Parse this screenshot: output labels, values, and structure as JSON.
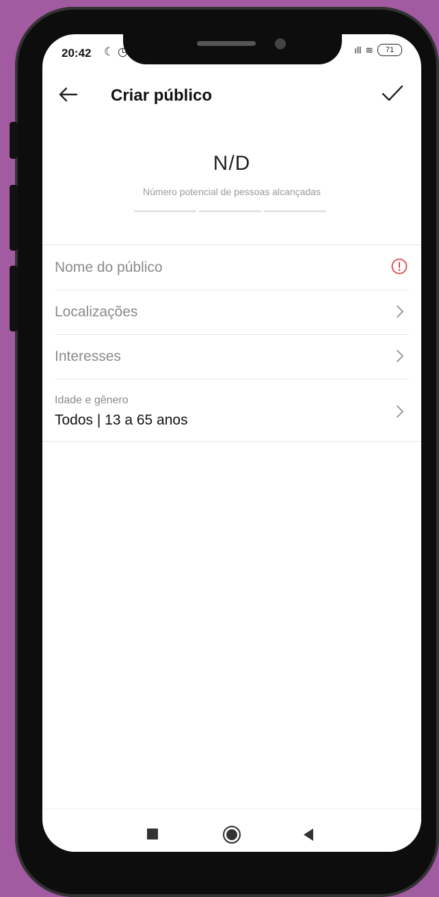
{
  "status_bar": {
    "time": "20:42",
    "left_icons": "☾ ◷",
    "signal": "ıll",
    "wifi": "≋",
    "battery": "71"
  },
  "header": {
    "title": "Criar público",
    "back_icon": "arrow-left-icon",
    "confirm_icon": "checkmark-icon"
  },
  "reach": {
    "value": "N/D",
    "caption": "Número potencial de pessoas alcançadas"
  },
  "form": {
    "audience_name": {
      "label": "Nome do público",
      "icon": "warning-icon",
      "warning_color": "#e0474c"
    },
    "locations": {
      "label": "Localizações"
    },
    "interests": {
      "label": "Interesses"
    },
    "age_gender": {
      "label": "Idade e gênero",
      "value": "Todos | 13 a 65 anos"
    }
  },
  "navbar": {
    "recent_icon": "square-icon",
    "home_icon": "circle-icon",
    "back_icon": "triangle-back-icon"
  }
}
